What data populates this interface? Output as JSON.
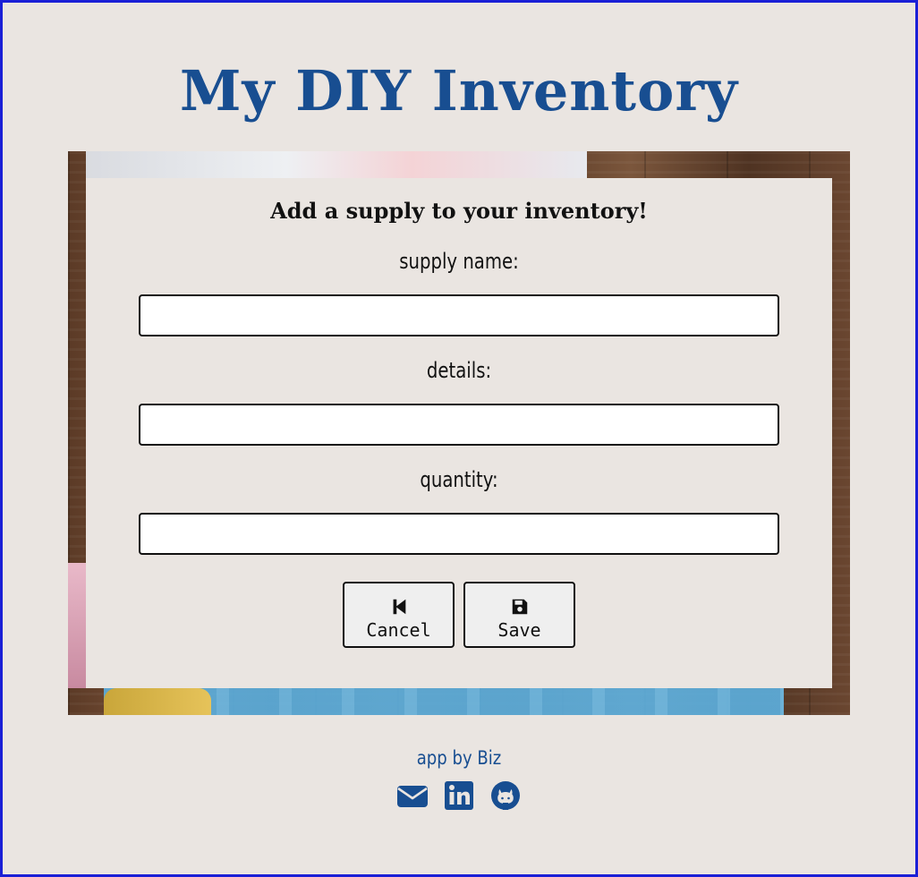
{
  "header": {
    "title": "My DIY Inventory"
  },
  "form": {
    "heading": "Add a supply to your inventory!",
    "fields": [
      {
        "label": "supply name:",
        "value": "",
        "placeholder": ""
      },
      {
        "label": "details:",
        "value": "",
        "placeholder": ""
      },
      {
        "label": "quantity:",
        "value": "",
        "placeholder": ""
      }
    ],
    "buttons": {
      "cancel": {
        "label": "Cancel",
        "icon": "skip-back-icon"
      },
      "save": {
        "label": "Save",
        "icon": "floppy-disk-icon"
      }
    }
  },
  "footer": {
    "credit": "app by Biz",
    "links": [
      {
        "icon": "envelope-icon"
      },
      {
        "icon": "linkedin-icon"
      },
      {
        "icon": "github-icon"
      }
    ]
  },
  "colors": {
    "accent": "#184e91",
    "background": "#eae5e1",
    "frame_border": "#1a1fd6",
    "text": "#111111"
  }
}
